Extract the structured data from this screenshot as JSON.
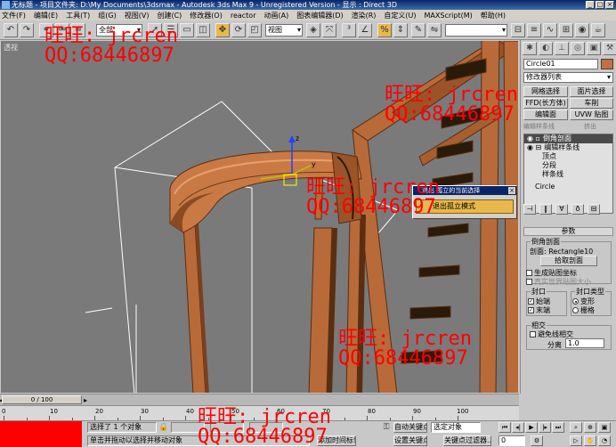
{
  "window": {
    "title": "无标题  - 项目文件夹: D:\\My Documents\\3dsmax  - Autodesk 3ds Max 9  - Unregistered Version  - 显示 : Direct 3D",
    "buttons": [
      "_",
      "□",
      "×"
    ]
  },
  "menu": [
    "文件(F)",
    "编辑(E)",
    "工具(T)",
    "组(G)",
    "视图(V)",
    "创建(C)",
    "修改器(O)",
    "reactor",
    "动画(A)",
    "图表编辑器(D)",
    "渲染(R)",
    "自定义(U)",
    "MAXScript(M)",
    "帮助(H)"
  ],
  "toolbar": {
    "selection_filter": "全部",
    "reference_coord": "视图",
    "icons": [
      "undo-icon",
      "redo-icon",
      "link-icon",
      "unlink-icon",
      "bind-icon",
      "select-icon",
      "select-by-name-icon",
      "rect-select-icon",
      "window-crossing-icon",
      "move-icon",
      "rotate-icon",
      "scale-icon",
      "pivot-icon",
      "select-manipulate-icon",
      "snap-icon",
      "angle-snap-icon",
      "percent-snap-icon",
      "spinner-snap-icon",
      "named-selection-icon",
      "mirror-icon",
      "align-icon",
      "layer-icon",
      "curve-editor-icon",
      "schematic-icon",
      "material-editor-icon",
      "render-setup-icon",
      "render-icon",
      "quick-render-icon"
    ]
  },
  "viewport": {
    "label": "透视"
  },
  "popup": {
    "title": "退出 孤立的当前选择",
    "close": "×",
    "button": "退出孤立模式"
  },
  "panel": {
    "object_name": "Circle01",
    "modifier_list": "修改器列表",
    "mod_buttons": [
      "网格选择",
      "面片选择",
      "FFD(长方体)",
      "车削",
      "编辑面",
      "UVW 贴图"
    ],
    "section_spline": "编辑样条线",
    "section_extrude": "挤出",
    "stack": [
      "倒角剖面",
      "编辑样条线",
      "顶点",
      "分段",
      "样条线",
      "Circle"
    ],
    "rollout_title": "参数",
    "bevel_profile_group": "倒角剖面",
    "profile_label": "剖面: Rectangle10",
    "pick_profile": "拾取剖面",
    "gen_mapping": "生成贴图坐标",
    "real_world": "真实世界贴图大小",
    "capping_group": "封口",
    "cap_start": "始端",
    "cap_end": "末端",
    "cap_type_group": "封口类型",
    "cap_morph": "变形",
    "cap_grid": "栅格",
    "intersect_group": "相交",
    "avoid_line": "避免线相交",
    "separation_label": "分离",
    "separation_value": "1.0"
  },
  "timeline": {
    "frame": "0 / 100",
    "ticks": [
      "0",
      "10",
      "20",
      "30",
      "40",
      "50",
      "60",
      "70",
      "80",
      "90",
      "100"
    ]
  },
  "status": {
    "selected": "选择了 1 个对象",
    "prompt": "单击并拖动以选择并移动对象",
    "add_time_tag": "添加时间标记",
    "auto_key": "自动关键点",
    "set_key": "设置关键点",
    "key_filter_sel": "选定对象",
    "key_filters": "关键点过滤器...",
    "current_frame": "0"
  },
  "watermarks": [
    {
      "line1": "旺旺: jrcren",
      "line2": "QQ:68446897"
    },
    {
      "line1": "旺旺: jrcren",
      "line2": "QQ:68446897"
    },
    {
      "line1": "旺旺: jrcren",
      "line2": "QQ:68446897"
    },
    {
      "line1": "旺旺: jrcren",
      "line2": "QQ:68446897"
    },
    {
      "line1": "旺旺: jrcren",
      "line2": "QQ:68446897"
    }
  ],
  "colors": {
    "wood": "#b86a38",
    "wood_dark": "#5a2e12",
    "selection_yellow": "#e8b84a",
    "watermark": "#ff0000"
  }
}
